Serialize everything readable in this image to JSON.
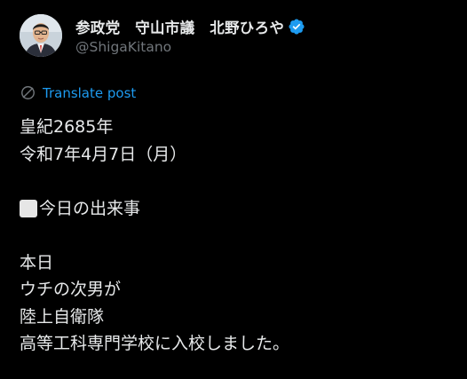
{
  "author": {
    "display_name": "参政党　守山市議　北野ひろや",
    "handle": "@ShigaKitano",
    "verified": true,
    "verified_color": "#1d9bf0"
  },
  "translate": {
    "label": "Translate post",
    "icon": "translate-icon",
    "color": "#1d9bf0"
  },
  "post": {
    "line1": "皇紀2685年",
    "line2": "令和7年4月7日（月）",
    "section_emoji": "white-square-emoji",
    "section_heading": "今日の出来事",
    "line4": "本日",
    "line5": "ウチの次男が",
    "line6": "陸上自衛隊",
    "line7": "高等工科専門学校に入校しました。"
  },
  "theme": {
    "background": "#000000",
    "text": "#e7e9ea",
    "secondary_text": "#71767b"
  }
}
